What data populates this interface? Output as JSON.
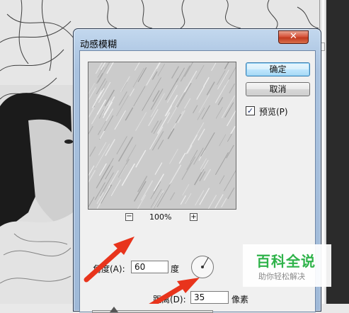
{
  "dialog": {
    "title": "动感模糊",
    "close_symbol": "✕"
  },
  "buttons": {
    "ok": "确定",
    "cancel": "取消"
  },
  "preview": {
    "checked": true,
    "label": "预览(P)",
    "zoom_out_symbol": "−",
    "zoom_in_symbol": "+",
    "zoom_level": "100%"
  },
  "angle": {
    "label": "角度(A):",
    "value": "60",
    "unit": "度",
    "degrees": 60
  },
  "distance": {
    "label": "距离(D):",
    "value": "35",
    "unit": "像素",
    "slider_fraction": 0.18
  },
  "annotations": {
    "arrow_color": "#e8341c"
  },
  "watermark": {
    "main": "百科全说",
    "sub": "助你轻松解决"
  }
}
